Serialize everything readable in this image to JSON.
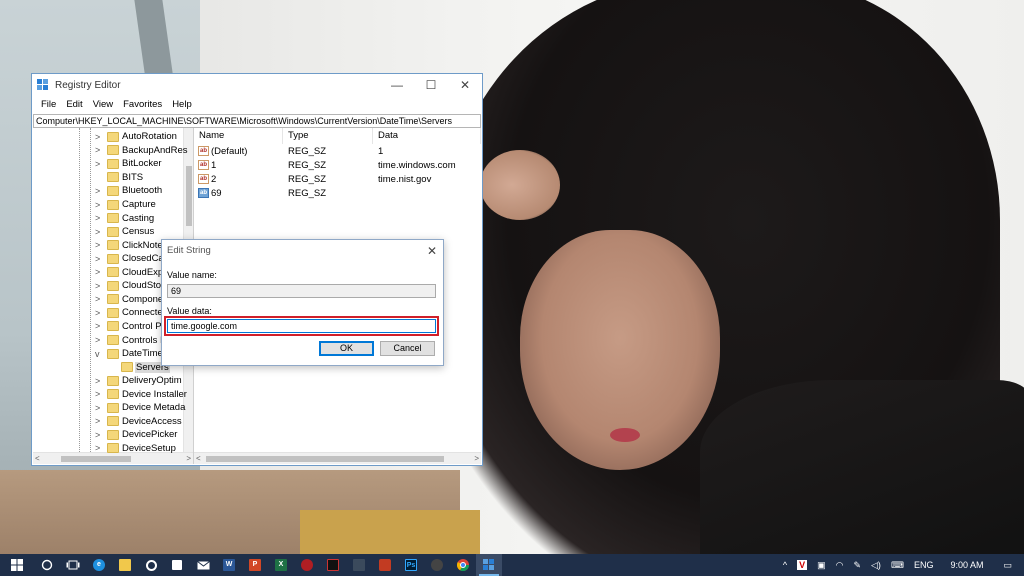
{
  "window": {
    "title": "Registry Editor",
    "controls": {
      "minimize": "—",
      "maximize": "☐",
      "close": "✕"
    }
  },
  "menu": [
    "File",
    "Edit",
    "View",
    "Favorites",
    "Help"
  ],
  "address": "Computer\\HKEY_LOCAL_MACHINE\\SOFTWARE\\Microsoft\\Windows\\CurrentVersion\\DateTime\\Servers",
  "tree": {
    "items": [
      {
        "label": "AutoRotation",
        "expander": ">"
      },
      {
        "label": "BackupAndRes",
        "expander": ">"
      },
      {
        "label": "BitLocker",
        "expander": ">"
      },
      {
        "label": "BITS",
        "expander": ""
      },
      {
        "label": "Bluetooth",
        "expander": ">"
      },
      {
        "label": "Capture",
        "expander": ">"
      },
      {
        "label": "Casting",
        "expander": ">"
      },
      {
        "label": "Census",
        "expander": ">"
      },
      {
        "label": "ClickNote",
        "expander": ">"
      },
      {
        "label": "ClosedCa",
        "expander": ">"
      },
      {
        "label": "CloudExp",
        "expander": ">"
      },
      {
        "label": "CloudSto",
        "expander": ">"
      },
      {
        "label": "Compone",
        "expander": ">"
      },
      {
        "label": "Connecte",
        "expander": ">"
      },
      {
        "label": "Control P",
        "expander": ">"
      },
      {
        "label": "Controls I",
        "expander": ">"
      },
      {
        "label": "DateTime",
        "expander": "v"
      },
      {
        "label": "Servers",
        "expander": "",
        "child": true
      },
      {
        "label": "DeliveryOptim",
        "expander": ">"
      },
      {
        "label": "Device Installer",
        "expander": ">"
      },
      {
        "label": "Device Metada",
        "expander": ">"
      },
      {
        "label": "DeviceAccess",
        "expander": ">"
      },
      {
        "label": "DevicePicker",
        "expander": ">"
      },
      {
        "label": "DeviceSetup",
        "expander": ">"
      }
    ]
  },
  "list": {
    "columns": [
      "Name",
      "Type",
      "Data"
    ],
    "rows": [
      {
        "name": "(Default)",
        "type": "REG_SZ",
        "data": "1"
      },
      {
        "name": "1",
        "type": "REG_SZ",
        "data": "time.windows.com"
      },
      {
        "name": "2",
        "type": "REG_SZ",
        "data": "time.nist.gov"
      },
      {
        "name": "69",
        "type": "REG_SZ",
        "data": ""
      }
    ]
  },
  "dialog": {
    "title": "Edit String",
    "close": "✕",
    "value_name_label": "Value name:",
    "value_name": "69",
    "value_data_label": "Value data:",
    "value_data": "time.google.com",
    "ok": "OK",
    "cancel": "Cancel"
  },
  "taskbar": {
    "apps": [
      "windows-start",
      "search",
      "task-view",
      "edge",
      "file-explorer",
      "chrome-alt",
      "store",
      "mail",
      "word",
      "powerpoint",
      "excel",
      "app-red",
      "app-black",
      "app-dark",
      "app-yellow",
      "photoshop",
      "app-eye",
      "chrome",
      "registry"
    ],
    "tray": {
      "language": "ENG",
      "time": "9:00 AM"
    }
  },
  "colors": {
    "taskbar": "#1f2f49",
    "highlight_box": "#d0202a",
    "accent": "#0078d7"
  }
}
